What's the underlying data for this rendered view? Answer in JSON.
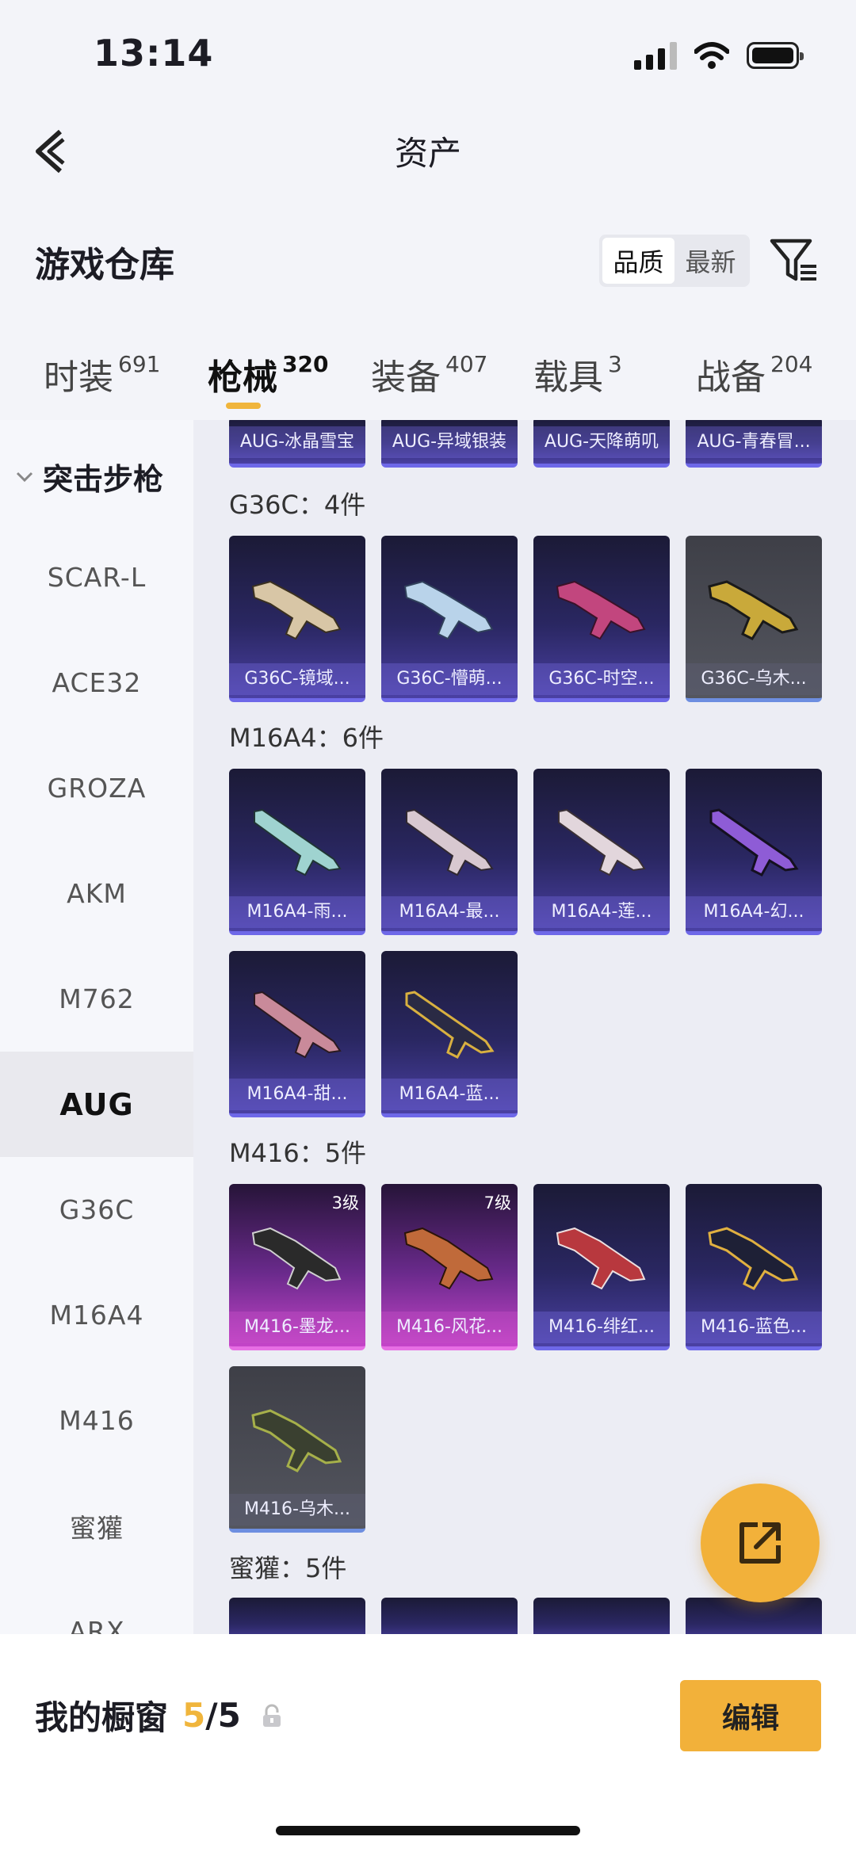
{
  "status": {
    "time": "13:14"
  },
  "nav": {
    "title": "资产"
  },
  "warehouse": {
    "title": "游戏仓库",
    "sort_quality": "品质",
    "sort_latest": "最新"
  },
  "tabs": [
    {
      "label": "时装",
      "count": "691"
    },
    {
      "label": "枪械",
      "count": "320"
    },
    {
      "label": "装备",
      "count": "407"
    },
    {
      "label": "载具",
      "count": "3"
    },
    {
      "label": "战备",
      "count": "204"
    }
  ],
  "sidebar": {
    "category": "突击步枪",
    "items": [
      "SCAR-L",
      "ACE32",
      "GROZA",
      "AKM",
      "M762",
      "AUG",
      "G36C",
      "M16A4",
      "M416",
      "蜜獾",
      "ARX"
    ],
    "active": "AUG"
  },
  "top_row": [
    "AUG-冰晶雪宝",
    "AUG-异域银装",
    "AUG-天降萌叽",
    "AUG-青春冒..."
  ],
  "sections": [
    {
      "title": "G36C：4件",
      "items": [
        "G36C-镜域...",
        "G36C-懵萌...",
        "G36C-时空...",
        "G36C-乌木..."
      ]
    },
    {
      "title": "M16A4：6件",
      "items": [
        "M16A4-雨...",
        "M16A4-最...",
        "M16A4-莲...",
        "M16A4-幻...",
        "M16A4-甜...",
        "M16A4-蓝..."
      ]
    },
    {
      "title": "M416：5件",
      "items": [
        "M416-墨龙...",
        "M416-风花...",
        "M416-绯红...",
        "M416-蓝色...",
        "M416-乌木..."
      ],
      "levels": [
        "3级",
        "7级"
      ]
    },
    {
      "title": "蜜獾：5件"
    }
  ],
  "bottom": {
    "showcase_label": "我的橱窗",
    "showcase_current": "5",
    "showcase_total": "/5",
    "edit_label": "编辑"
  },
  "colors": {
    "accent": "#f2b13a",
    "card_purple": "#4a40a3",
    "card_pink": "#c444c8",
    "card_grey": "#54565f"
  },
  "icons": [
    "back-arrow-icon",
    "filter-icon",
    "lock-icon",
    "share-icon",
    "signal-icon",
    "wifi-icon",
    "battery-icon",
    "chevron-down-icon",
    "rifle-icon"
  ]
}
